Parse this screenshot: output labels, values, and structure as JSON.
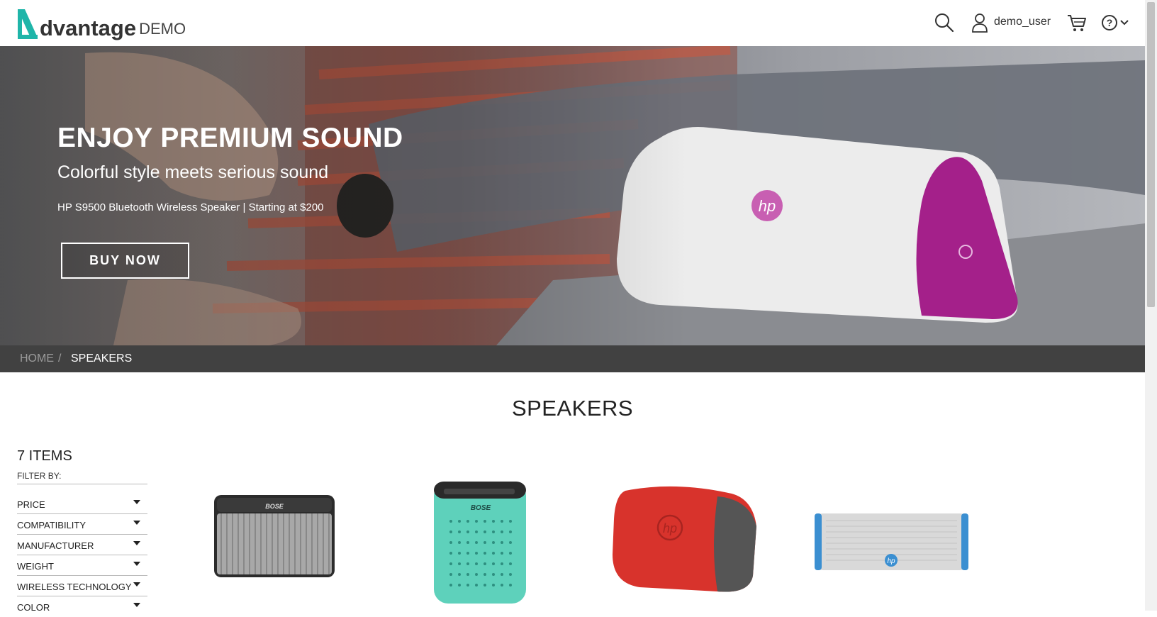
{
  "header": {
    "logo_text": "dvantage",
    "logo_demo": "DEMO",
    "username": "demo_user"
  },
  "hero": {
    "title": "ENJOY PREMIUM SOUND",
    "subtitle": "Colorful style meets serious sound",
    "description": "HP S9500 Bluetooth Wireless Speaker | Starting at $200",
    "button_label": "BUY NOW",
    "logo_text": "hp"
  },
  "breadcrumb": {
    "home": "HOME",
    "separator": "/",
    "current": "SPEAKERS"
  },
  "page_title": "SPEAKERS",
  "sidebar": {
    "items_count": "7 ITEMS",
    "filter_by": "FILTER BY:",
    "filters": [
      "PRICE",
      "COMPATIBILITY",
      "MANUFACTURER",
      "WEIGHT",
      "WIRELESS TECHNOLOGY",
      "COLOR"
    ]
  },
  "products": [
    {
      "brand": "BOSE",
      "color": "#9a9a9a"
    },
    {
      "brand": "BOSE",
      "color": "#6fd6c2"
    },
    {
      "brand": "hp",
      "color": "#d8332c"
    },
    {
      "brand": "hp",
      "color": "#d9d9d9"
    }
  ],
  "colors": {
    "accent": "#1fb5a9",
    "breadcrumb_bg": "#414141",
    "hero_speaker_accent": "#a4208a"
  }
}
